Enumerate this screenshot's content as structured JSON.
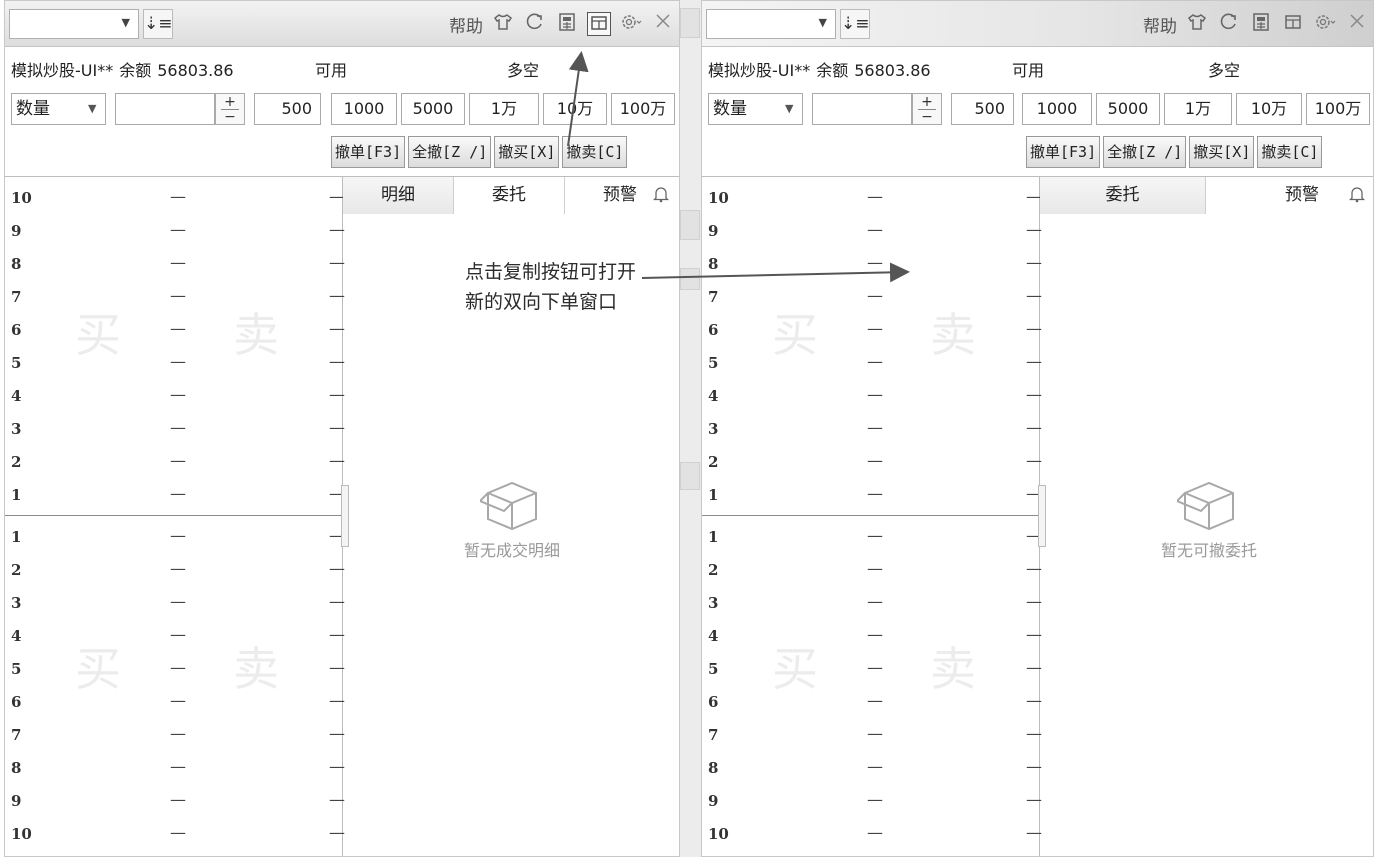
{
  "windows": [
    {
      "toolbar": {
        "help_label": "帮助"
      },
      "account": {
        "name_label": "模拟炒股-UI**",
        "balance_label": "余额",
        "balance_value": "56803.86",
        "available_label": "可用",
        "long_short_label": "多空"
      },
      "quantity": {
        "mode_label": "数量",
        "input_value": "",
        "stepper_plus": "+",
        "stepper_minus": "−",
        "presets": [
          "500",
          "1000",
          "5000",
          "1万",
          "10万",
          "100万"
        ]
      },
      "cancel_buttons": [
        "撤单[F3]",
        "全撤[Z /]",
        "撤买[X]",
        "撤卖[C]"
      ],
      "tabs": [
        "明细",
        "委托",
        "预警"
      ],
      "empty_message": "暂无成交明细"
    },
    {
      "toolbar": {
        "help_label": "帮助"
      },
      "account": {
        "name_label": "模拟炒股-UI**",
        "balance_label": "余额",
        "balance_value": "56803.86",
        "available_label": "可用",
        "long_short_label": "多空"
      },
      "quantity": {
        "mode_label": "数量",
        "input_value": "",
        "stepper_plus": "+",
        "stepper_minus": "−",
        "presets": [
          "500",
          "1000",
          "5000",
          "1万",
          "10万",
          "100万"
        ]
      },
      "cancel_buttons": [
        "撤单[F3]",
        "全撤[Z /]",
        "撤买[X]",
        "撤卖[C]"
      ],
      "tabs": [
        "委托",
        "预警"
      ],
      "empty_message": "暂无可撤委托"
    }
  ],
  "order_book": {
    "sell_levels": [
      "10",
      "9",
      "8",
      "7",
      "6",
      "5",
      "4",
      "3",
      "2",
      "1"
    ],
    "buy_levels": [
      "1",
      "2",
      "3",
      "4",
      "5",
      "6",
      "7",
      "8",
      "9",
      "10"
    ],
    "placeholder": "—",
    "buy_watermark": "买",
    "sell_watermark": "卖"
  },
  "annotation": {
    "line1": "点击复制按钮可打开",
    "line2": "新的双向下单窗口"
  },
  "icons": [
    "dropdown-arrow-icon",
    "sort-icon",
    "shirt-icon",
    "refresh-icon",
    "calculator-icon",
    "copy-window-icon",
    "settings-icon",
    "close-icon",
    "bell-icon",
    "empty-box-icon"
  ],
  "colors": {
    "toolbar_bg": "#e6e6e6",
    "border": "#bdbdbd",
    "empty_text": "#9a9a9a",
    "arrow": "#555555"
  }
}
